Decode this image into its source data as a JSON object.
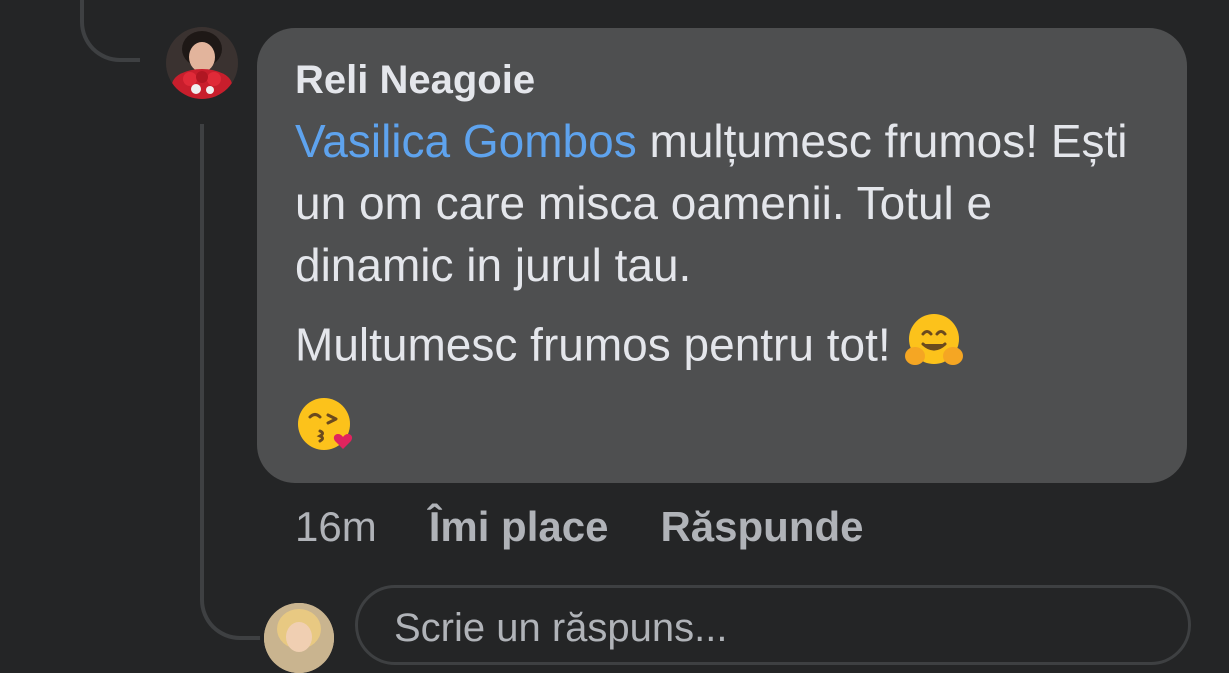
{
  "comment": {
    "author": "Reli Neagoie",
    "mention": "Vasilica Gombos",
    "text_line1": " mulțumesc frumos! Ești un om care misca oamenii. Totul e dinamic in jurul tau.",
    "text_line2": "Multumesc frumos pentru tot! ",
    "emoji_hug": "hugging-face",
    "emoji_kiss": "face-blowing-kiss"
  },
  "actions": {
    "time": "16m",
    "like_label": "Îmi place",
    "reply_label": "Răspunde"
  },
  "reply_box": {
    "placeholder": "Scrie un răspuns..."
  },
  "colors": {
    "background": "#242526",
    "bubble": "#4e4f50",
    "mention": "#5ea3ee",
    "text": "#e4e6eb",
    "muted": "#b0b3b8"
  }
}
